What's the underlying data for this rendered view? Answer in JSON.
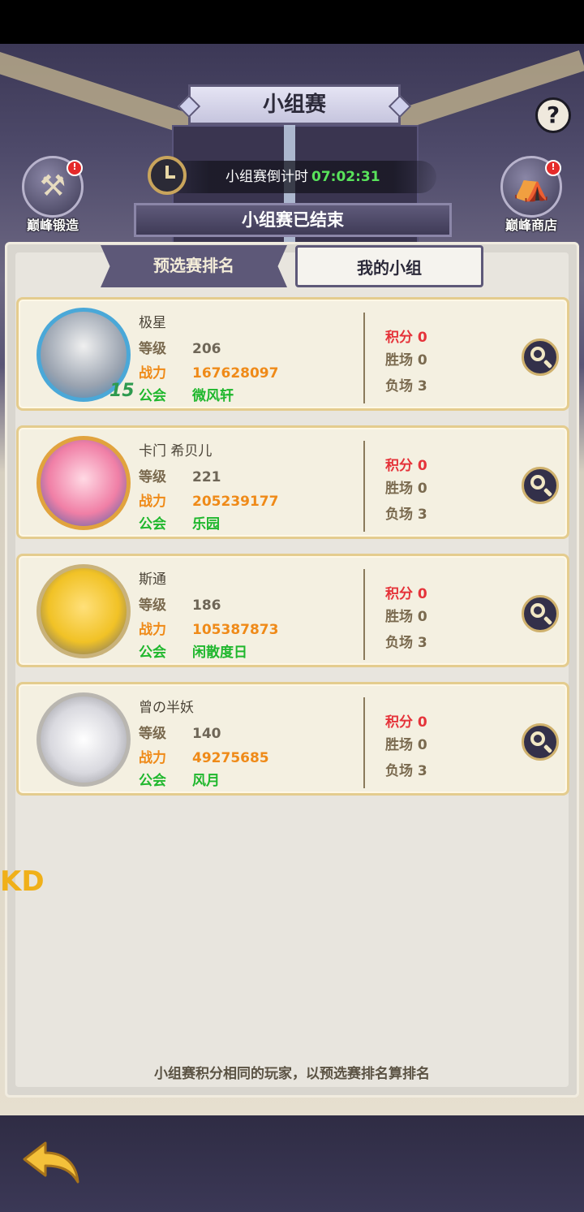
{
  "header": {
    "title": "小组赛"
  },
  "timer": {
    "label": "小组赛倒计时",
    "value": "07:02:31"
  },
  "status": "小组赛已结束",
  "side_buttons": {
    "forge": {
      "label": "巅峰锻造",
      "badge": "!"
    },
    "shop": {
      "label": "巅峰商店",
      "badge": "!"
    }
  },
  "help": {
    "label": "?"
  },
  "tabs": {
    "prelim": "预选赛排名",
    "mygroup": "我的小组"
  },
  "field_labels": {
    "level": "等级",
    "power": "战力",
    "guild": "公会",
    "points": "积分",
    "wins": "胜场",
    "losses": "负场"
  },
  "players": [
    {
      "name": "极星",
      "level": "206",
      "power": "167628097",
      "guild": "微风轩",
      "points": "0",
      "wins": "0",
      "losses": "3",
      "badge": "15"
    },
    {
      "name": "卡门 希贝儿",
      "level": "221",
      "power": "205239177",
      "guild": "乐园",
      "points": "0",
      "wins": "0",
      "losses": "3"
    },
    {
      "name": "斯通",
      "level": "186",
      "power": "105387873",
      "guild": "闲散度日",
      "points": "0",
      "wins": "0",
      "losses": "3"
    },
    {
      "name": "曾の半妖",
      "level": "140",
      "power": "49275685",
      "guild": "风月",
      "points": "0",
      "wins": "0",
      "losses": "3"
    }
  ],
  "footnote": "小组赛积分相同的玩家，以预选赛排名算排名",
  "overlay_text": "KD",
  "icons": {
    "back": "back-arrow-icon",
    "search": "magnifier-icon",
    "clock": "clock-icon"
  }
}
